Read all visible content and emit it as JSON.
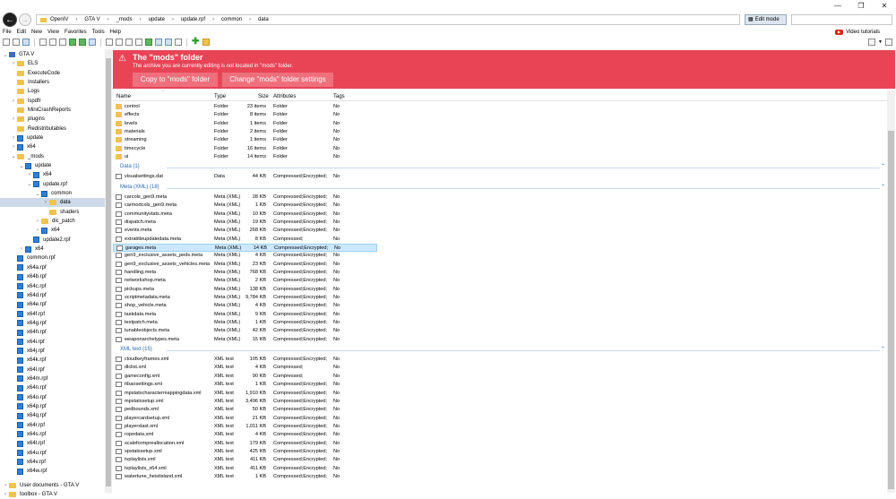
{
  "window_controls": {
    "minimize": "—",
    "maximize": "❐",
    "close": "✕"
  },
  "nav": {
    "back": "←",
    "forward": "→"
  },
  "breadcrumbs": [
    "OpenIV",
    "GTA V",
    "_mods",
    "update",
    "update.rpf",
    "common",
    "data"
  ],
  "edit_mode": "Edit mode",
  "search": {
    "placeholder": ""
  },
  "menu": [
    "File",
    "Edit",
    "New",
    "View",
    "Favorites",
    "Tools",
    "Help"
  ],
  "video_tutorials": "Video tutorials",
  "banner": {
    "title": "The \"mods\" folder",
    "subtitle": "The archive you are currently editing is not located in \"mods\" folder.",
    "btn_copy": "Copy to \"mods\" folder",
    "btn_change": "Change \"mods\" folder settings",
    "color": "#e84456"
  },
  "columns": {
    "name": "Name",
    "type": "Type",
    "size": "Size",
    "attributes": "Attributes",
    "tags": "Tags"
  },
  "folders": [
    {
      "name": "control",
      "type": "Folder",
      "size": "23 items",
      "attr": "Folder",
      "tags": "No"
    },
    {
      "name": "effects",
      "type": "Folder",
      "size": "8 items",
      "attr": "Folder",
      "tags": "No"
    },
    {
      "name": "levels",
      "type": "Folder",
      "size": "1 items",
      "attr": "Folder",
      "tags": "No"
    },
    {
      "name": "materials",
      "type": "Folder",
      "size": "2 items",
      "attr": "Folder",
      "tags": "No"
    },
    {
      "name": "streaming",
      "type": "Folder",
      "size": "1 items",
      "attr": "Folder",
      "tags": "No"
    },
    {
      "name": "timecycle",
      "type": "Folder",
      "size": "16 items",
      "attr": "Folder",
      "tags": "No"
    },
    {
      "name": "ui",
      "type": "Folder",
      "size": "14 items",
      "attr": "Folder",
      "tags": "No"
    }
  ],
  "groups": [
    {
      "label": "Data (1)",
      "rows": [
        {
          "name": "visualsettings.dat",
          "type": "Data",
          "size": "44 KB",
          "attr": "Compressed;Encrypted;",
          "tags": "No"
        }
      ]
    },
    {
      "label": "Meta (XML) (18)",
      "rows": [
        {
          "name": "carcols_gen9.meta",
          "type": "Meta (XML)",
          "size": "28 KB",
          "attr": "Compressed;Encrypted;",
          "tags": "No"
        },
        {
          "name": "carmodcols_gen9.meta",
          "type": "Meta (XML)",
          "size": "1 KB",
          "attr": "Compressed;Encrypted;",
          "tags": "No"
        },
        {
          "name": "communitystats.meta",
          "type": "Meta (XML)",
          "size": "10 KB",
          "attr": "Compressed;Encrypted;",
          "tags": "No"
        },
        {
          "name": "dispatch.meta",
          "type": "Meta (XML)",
          "size": "19 KB",
          "attr": "Compressed;Encrypted;",
          "tags": "No"
        },
        {
          "name": "events.meta",
          "type": "Meta (XML)",
          "size": "268 KB",
          "attr": "Compressed;Encrypted;",
          "tags": "No"
        },
        {
          "name": "extratitleupdatedata.meta",
          "type": "Meta (XML)",
          "size": "8 KB",
          "attr": "Compressed;",
          "tags": "No"
        },
        {
          "name": "garages.meta",
          "type": "Meta (XML)",
          "size": "14 KB",
          "attr": "Compressed;Encrypted;",
          "tags": "No",
          "selected": true
        },
        {
          "name": "gen9_exclusive_assets_peds.meta",
          "type": "Meta (XML)",
          "size": "4 KB",
          "attr": "Compressed;Encrypted;",
          "tags": "No"
        },
        {
          "name": "gen9_exclusive_assets_vehicles.meta",
          "type": "Meta (XML)",
          "size": "23 KB",
          "attr": "Compressed;Encrypted;",
          "tags": "No"
        },
        {
          "name": "handling.meta",
          "type": "Meta (XML)",
          "size": "768 KB",
          "attr": "Compressed;Encrypted;",
          "tags": "No"
        },
        {
          "name": "networkshop.meta",
          "type": "Meta (XML)",
          "size": "2 KB",
          "attr": "Compressed;Encrypted;",
          "tags": "No"
        },
        {
          "name": "pickups.meta",
          "type": "Meta (XML)",
          "size": "138 KB",
          "attr": "Compressed;Encrypted;",
          "tags": "No"
        },
        {
          "name": "scriptmetadata.meta",
          "type": "Meta (XML)",
          "size": "9,784 KB",
          "attr": "Compressed;Encrypted;",
          "tags": "No"
        },
        {
          "name": "shop_vehicle.meta",
          "type": "Meta (XML)",
          "size": "4 KB",
          "attr": "Compressed;Encrypted;",
          "tags": "No"
        },
        {
          "name": "taskdata.meta",
          "type": "Meta (XML)",
          "size": "9 KB",
          "attr": "Compressed;Encrypted;",
          "tags": "No"
        },
        {
          "name": "textpatch.meta",
          "type": "Meta (XML)",
          "size": "1 KB",
          "attr": "Compressed;Encrypted;",
          "tags": "No"
        },
        {
          "name": "tunableobjects.meta",
          "type": "Meta (XML)",
          "size": "42 KB",
          "attr": "Compressed;Encrypted;",
          "tags": "No"
        },
        {
          "name": "weaponarchetypes.meta",
          "type": "Meta (XML)",
          "size": "15 KB",
          "attr": "Compressed;Encrypted;",
          "tags": "No"
        }
      ]
    },
    {
      "label": "XML text (15)",
      "rows": [
        {
          "name": "cloudkeyframes.xml",
          "type": "XML text",
          "size": "105 KB",
          "attr": "Compressed;Encrypted;",
          "tags": "No"
        },
        {
          "name": "dlclist.xml",
          "type": "XML text",
          "size": "4 KB",
          "attr": "Compressed;",
          "tags": "No"
        },
        {
          "name": "gameconfig.xml",
          "type": "XML text",
          "size": "90 KB",
          "attr": "Compressed;",
          "tags": "No"
        },
        {
          "name": "hbaosettings.xml",
          "type": "XML text",
          "size": "1 KB",
          "attr": "Compressed;Encrypted;",
          "tags": "No"
        },
        {
          "name": "mpstatscharactermappingdata.xml",
          "type": "XML text",
          "size": "1,910 KB",
          "attr": "Compressed;Encrypted;",
          "tags": "No"
        },
        {
          "name": "mpstatssetup.xml",
          "type": "XML text",
          "size": "3,496 KB",
          "attr": "Compressed;Encrypted;",
          "tags": "No"
        },
        {
          "name": "pedbounds.xml",
          "type": "XML text",
          "size": "50 KB",
          "attr": "Compressed;Encrypted;",
          "tags": "No"
        },
        {
          "name": "playercardsetup.xml",
          "type": "XML text",
          "size": "21 KB",
          "attr": "Compressed;Encrypted;",
          "tags": "No"
        },
        {
          "name": "playerxlast.xml",
          "type": "XML text",
          "size": "1,011 KB",
          "attr": "Compressed;Encrypted;",
          "tags": "No"
        },
        {
          "name": "ropedata.xml",
          "type": "XML text",
          "size": "4 KB",
          "attr": "Compressed;Encrypted;",
          "tags": "No"
        },
        {
          "name": "scaleformpreallocation.xml",
          "type": "XML text",
          "size": "179 KB",
          "attr": "Compressed;Encrypted;",
          "tags": "No"
        },
        {
          "name": "spstatssetup.xml",
          "type": "XML text",
          "size": "425 KB",
          "attr": "Compressed;Encrypted;",
          "tags": "No"
        },
        {
          "name": "tvplaylists.xml",
          "type": "XML text",
          "size": "411 KB",
          "attr": "Compressed;Encrypted;",
          "tags": "No"
        },
        {
          "name": "tvplaylists_x64.xml",
          "type": "XML text",
          "size": "411 KB",
          "attr": "Compressed;Encrypted;",
          "tags": "No"
        },
        {
          "name": "watertune_heistisland.xml",
          "type": "XML text",
          "size": "1 KB",
          "attr": "Compressed;Encrypted;",
          "tags": "No"
        }
      ]
    }
  ],
  "tree": [
    {
      "label": "GTA V",
      "indent": 0,
      "arrow": "v",
      "icon": "pc"
    },
    {
      "label": "ELS",
      "indent": 1,
      "arrow": ">",
      "icon": "folder"
    },
    {
      "label": "ExecuteCode",
      "indent": 1,
      "arrow": "",
      "icon": "folder"
    },
    {
      "label": "Installers",
      "indent": 1,
      "arrow": "",
      "icon": "folder"
    },
    {
      "label": "Logs",
      "indent": 1,
      "arrow": "",
      "icon": "folder"
    },
    {
      "label": "lspdfr",
      "indent": 1,
      "arrow": ">",
      "icon": "folder"
    },
    {
      "label": "MiniCrashReports",
      "indent": 1,
      "arrow": "",
      "icon": "folder"
    },
    {
      "label": "plugins",
      "indent": 1,
      "arrow": ">",
      "icon": "folder"
    },
    {
      "label": "Redistributables",
      "indent": 1,
      "arrow": "",
      "icon": "folder"
    },
    {
      "label": "update",
      "indent": 1,
      "arrow": ">",
      "icon": "rpf"
    },
    {
      "label": "x64",
      "indent": 1,
      "arrow": ">",
      "icon": "rpf"
    },
    {
      "label": "_mods",
      "indent": 1,
      "arrow": "v",
      "icon": "folder"
    },
    {
      "label": "update",
      "indent": 2,
      "arrow": "v",
      "icon": "rpf"
    },
    {
      "label": "x64",
      "indent": 3,
      "arrow": ">",
      "icon": "rpf"
    },
    {
      "label": "update.rpf",
      "indent": 3,
      "arrow": "v",
      "icon": "rpf"
    },
    {
      "label": "common",
      "indent": 4,
      "arrow": "v",
      "icon": "rpf"
    },
    {
      "label": "data",
      "indent": 5,
      "arrow": ">",
      "icon": "folder",
      "selected": true
    },
    {
      "label": "shaders",
      "indent": 5,
      "arrow": "",
      "icon": "folder"
    },
    {
      "label": "dlc_patch",
      "indent": 4,
      "arrow": ">",
      "icon": "folder"
    },
    {
      "label": "x64",
      "indent": 4,
      "arrow": ">",
      "icon": "rpf"
    },
    {
      "label": "update2.rpf",
      "indent": 3,
      "arrow": "",
      "icon": "rpf"
    },
    {
      "label": "x64",
      "indent": 2,
      "arrow": ">",
      "icon": "rpf"
    },
    {
      "label": "common.rpf",
      "indent": 1,
      "arrow": "",
      "icon": "rpf"
    },
    {
      "label": "x64a.rpf",
      "indent": 1,
      "arrow": "",
      "icon": "rpf"
    },
    {
      "label": "x64b.rpf",
      "indent": 1,
      "arrow": "",
      "icon": "rpf"
    },
    {
      "label": "x64c.rpf",
      "indent": 1,
      "arrow": "",
      "icon": "rpf"
    },
    {
      "label": "x64d.rpf",
      "indent": 1,
      "arrow": "",
      "icon": "rpf"
    },
    {
      "label": "x64e.rpf",
      "indent": 1,
      "arrow": "",
      "icon": "rpf"
    },
    {
      "label": "x64f.rpf",
      "indent": 1,
      "arrow": "",
      "icon": "rpf"
    },
    {
      "label": "x64g.rpf",
      "indent": 1,
      "arrow": "",
      "icon": "rpf"
    },
    {
      "label": "x64h.rpf",
      "indent": 1,
      "arrow": "",
      "icon": "rpf"
    },
    {
      "label": "x64i.rpf",
      "indent": 1,
      "arrow": "",
      "icon": "rpf"
    },
    {
      "label": "x64j.rpf",
      "indent": 1,
      "arrow": "",
      "icon": "rpf"
    },
    {
      "label": "x64k.rpf",
      "indent": 1,
      "arrow": "",
      "icon": "rpf"
    },
    {
      "label": "x64l.rpf",
      "indent": 1,
      "arrow": "",
      "icon": "rpf"
    },
    {
      "label": "x64m.rpf",
      "indent": 1,
      "arrow": "",
      "icon": "rpf"
    },
    {
      "label": "x64n.rpf",
      "indent": 1,
      "arrow": "",
      "icon": "rpf"
    },
    {
      "label": "x64o.rpf",
      "indent": 1,
      "arrow": "",
      "icon": "rpf"
    },
    {
      "label": "x64p.rpf",
      "indent": 1,
      "arrow": "",
      "icon": "rpf"
    },
    {
      "label": "x64q.rpf",
      "indent": 1,
      "arrow": "",
      "icon": "rpf"
    },
    {
      "label": "x64r.rpf",
      "indent": 1,
      "arrow": "",
      "icon": "rpf"
    },
    {
      "label": "x64s.rpf",
      "indent": 1,
      "arrow": "",
      "icon": "rpf"
    },
    {
      "label": "x64t.rpf",
      "indent": 1,
      "arrow": "",
      "icon": "rpf"
    },
    {
      "label": "x64u.rpf",
      "indent": 1,
      "arrow": "",
      "icon": "rpf"
    },
    {
      "label": "x64v.rpf",
      "indent": 1,
      "arrow": "",
      "icon": "rpf"
    },
    {
      "label": "x64w.rpf",
      "indent": 1,
      "arrow": "",
      "icon": "rpf"
    }
  ],
  "bottom_tree": [
    "User documents - GTA V",
    "toolbox - GTA V"
  ]
}
